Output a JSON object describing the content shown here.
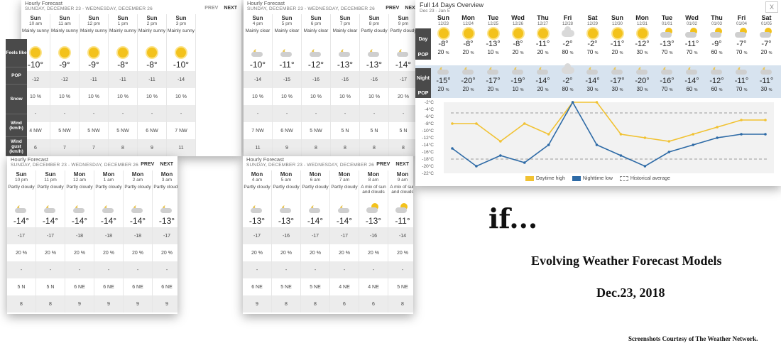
{
  "common": {
    "title": "Hourly Forecast",
    "range": "SUNDAY, DECEMBER 23 - WEDNESDAY, DECEMBER 26",
    "prev": "PREV",
    "next": "NEXT"
  },
  "side_labels": [
    "Feels like",
    "POP",
    "Snow",
    "Wind (km/h)",
    "Wind gust (km/h)"
  ],
  "panel1": {
    "cols": [
      {
        "day": "Sun",
        "time": "10 am",
        "cond": "Mainly sunny",
        "icon": "sun",
        "temp": "-10°",
        "feels": "-12",
        "pop": "10 %",
        "snow": "-",
        "wind": "4 NW",
        "gust": "6"
      },
      {
        "day": "Sun",
        "time": "11 am",
        "cond": "Mainly sunny",
        "icon": "sun",
        "temp": "-9°",
        "feels": "-12",
        "pop": "10 %",
        "snow": "-",
        "wind": "5 NW",
        "gust": "7"
      },
      {
        "day": "Sun",
        "time": "12 pm",
        "cond": "Mainly sunny",
        "icon": "sun",
        "temp": "-9°",
        "feels": "-11",
        "pop": "10 %",
        "snow": "-",
        "wind": "5 NW",
        "gust": "7"
      },
      {
        "day": "Sun",
        "time": "1 pm",
        "cond": "Mainly sunny",
        "icon": "sun",
        "temp": "-8°",
        "feels": "-11",
        "pop": "10 %",
        "snow": "-",
        "wind": "5 NW",
        "gust": "8"
      },
      {
        "day": "Sun",
        "time": "2 pm",
        "cond": "Mainly sunny",
        "icon": "sun",
        "temp": "-8°",
        "feels": "-11",
        "pop": "10 %",
        "snow": "-",
        "wind": "6 NW",
        "gust": "9"
      },
      {
        "day": "Sun",
        "time": "3 pm",
        "cond": "Mainly sunny",
        "icon": "sun",
        "temp": "-10°",
        "feels": "-14",
        "pop": "10 %",
        "snow": "-",
        "wind": "7 NW",
        "gust": "11"
      }
    ]
  },
  "panel2": {
    "cols": [
      {
        "day": "Sun",
        "time": "4 pm",
        "cond": "Mainly clear",
        "icon": "moon",
        "temp": "-10°",
        "feels": "-14",
        "pop": "10 %",
        "snow": "-",
        "wind": "7 NW",
        "gust": "11"
      },
      {
        "day": "Sun",
        "time": "5 pm",
        "cond": "Mainly clear",
        "icon": "moon",
        "temp": "-11°",
        "feels": "-15",
        "pop": "10 %",
        "snow": "-",
        "wind": "6 NW",
        "gust": "9"
      },
      {
        "day": "Sun",
        "time": "6 pm",
        "cond": "Mainly clear",
        "icon": "moon",
        "temp": "-12°",
        "feels": "-16",
        "pop": "10 %",
        "snow": "-",
        "wind": "5 NW",
        "gust": "8"
      },
      {
        "day": "Sun",
        "time": "7 pm",
        "cond": "Mainly clear",
        "icon": "moon",
        "temp": "-13°",
        "feels": "-16",
        "pop": "10 %",
        "snow": "-",
        "wind": "5 N",
        "gust": "8"
      },
      {
        "day": "Sun",
        "time": "8 pm",
        "cond": "Partly cloudy",
        "icon": "moon",
        "temp": "-13°",
        "feels": "-16",
        "pop": "10 %",
        "snow": "-",
        "wind": "5 N",
        "gust": "8"
      },
      {
        "day": "Sun",
        "time": "9 pm",
        "cond": "Partly cloudy",
        "icon": "moon",
        "temp": "-14°",
        "feels": "-17",
        "pop": "20 %",
        "snow": "-",
        "wind": "5 N",
        "gust": "8"
      }
    ]
  },
  "panel3": {
    "cols": [
      {
        "day": "Sun",
        "time": "10 pm",
        "cond": "Partly cloudy",
        "icon": "moon",
        "temp": "-14°",
        "feels": "-17",
        "pop": "20 %",
        "snow": "-",
        "wind": "5 N",
        "gust": "8"
      },
      {
        "day": "Sun",
        "time": "11 pm",
        "cond": "Partly cloudy",
        "icon": "moon",
        "temp": "-14°",
        "feels": "-17",
        "pop": "20 %",
        "snow": "-",
        "wind": "5 N",
        "gust": "8"
      },
      {
        "day": "Mon",
        "time": "12 am",
        "cond": "Partly cloudy",
        "icon": "moon",
        "temp": "-14°",
        "feels": "-18",
        "pop": "20 %",
        "snow": "-",
        "wind": "6 NE",
        "gust": "9"
      },
      {
        "day": "Mon",
        "time": "1 am",
        "cond": "Partly cloudy",
        "icon": "moon",
        "temp": "-14°",
        "feels": "-18",
        "pop": "20 %",
        "snow": "-",
        "wind": "6 NE",
        "gust": "9"
      },
      {
        "day": "Mon",
        "time": "2 am",
        "cond": "Partly cloudy",
        "icon": "moon",
        "temp": "-14°",
        "feels": "-18",
        "pop": "20 %",
        "snow": "-",
        "wind": "6 NE",
        "gust": "9"
      },
      {
        "day": "Mon",
        "time": "3 am",
        "cond": "Partly cloudy",
        "icon": "moon",
        "temp": "-13°",
        "feels": "-17",
        "pop": "20 %",
        "snow": "-",
        "wind": "6 NE",
        "gust": "9"
      }
    ]
  },
  "panel4": {
    "cols": [
      {
        "day": "Mon",
        "time": "4 am",
        "cond": "Partly cloudy",
        "icon": "moon",
        "temp": "-13°",
        "feels": "-17",
        "pop": "20 %",
        "snow": "-",
        "wind": "6 NE",
        "gust": "9"
      },
      {
        "day": "Mon",
        "time": "5 am",
        "cond": "Partly cloudy",
        "icon": "moon",
        "temp": "-13°",
        "feels": "-16",
        "pop": "20 %",
        "snow": "-",
        "wind": "5 NE",
        "gust": "8"
      },
      {
        "day": "Mon",
        "time": "6 am",
        "cond": "Partly cloudy",
        "icon": "moon",
        "temp": "-14°",
        "feels": "-17",
        "pop": "20 %",
        "snow": "-",
        "wind": "5 NE",
        "gust": "8"
      },
      {
        "day": "Mon",
        "time": "7 am",
        "cond": "Partly cloudy",
        "icon": "moon",
        "temp": "-14°",
        "feels": "-17",
        "pop": "20 %",
        "snow": "-",
        "wind": "4 NE",
        "gust": "6"
      },
      {
        "day": "Mon",
        "time": "8 am",
        "cond": "A mix of sun and clouds",
        "icon": "pc",
        "temp": "-13°",
        "feels": "-16",
        "pop": "20 %",
        "snow": "-",
        "wind": "4 NE",
        "gust": "6"
      },
      {
        "day": "Mon",
        "time": "9 am",
        "cond": "A mix of sun and clouds",
        "icon": "pc",
        "temp": "-11°",
        "feels": "-14",
        "pop": "20 %",
        "snow": "-",
        "wind": "5 NE",
        "gust": "8"
      }
    ]
  },
  "overview": {
    "title": "Full 14 Days Overview",
    "sub": "Dec 23 - Jan 5",
    "close": "X",
    "day_label": "Day",
    "pop_label": "POP",
    "night_label": "Night",
    "days": [
      {
        "d": "Sun",
        "date": "12/23",
        "hi": "-8°",
        "dpop": "20",
        "lo": "-15°",
        "npop": "20"
      },
      {
        "d": "Mon",
        "date": "12/24",
        "hi": "-8°",
        "dpop": "20",
        "lo": "-20°",
        "npop": "20"
      },
      {
        "d": "Tue",
        "date": "12/25",
        "hi": "-13°",
        "dpop": "10",
        "lo": "-17°",
        "npop": "20"
      },
      {
        "d": "Wed",
        "date": "12/26",
        "hi": "-8°",
        "dpop": "20",
        "lo": "-19°",
        "npop": "10"
      },
      {
        "d": "Thu",
        "date": "12/27",
        "hi": "-11°",
        "dpop": "20",
        "lo": "-14°",
        "npop": "20"
      },
      {
        "d": "Fri",
        "date": "12/28",
        "hi": "-2°",
        "dpop": "80",
        "lo": "-2°",
        "npop": "80"
      },
      {
        "d": "Sat",
        "date": "12/29",
        "hi": "-2°",
        "dpop": "70",
        "lo": "-14°",
        "npop": "30"
      },
      {
        "d": "Sun",
        "date": "12/30",
        "hi": "-11°",
        "dpop": "20",
        "lo": "-17°",
        "npop": "30"
      },
      {
        "d": "Mon",
        "date": "12/31",
        "hi": "-12°",
        "dpop": "30",
        "lo": "-20°",
        "npop": "30"
      },
      {
        "d": "Tue",
        "date": "01/01",
        "hi": "-13°",
        "dpop": "70",
        "lo": "-16°",
        "npop": "70"
      },
      {
        "d": "Wed",
        "date": "01/02",
        "hi": "-11°",
        "dpop": "70",
        "lo": "-14°",
        "npop": "60"
      },
      {
        "d": "Thu",
        "date": "01/03",
        "hi": "-9°",
        "dpop": "60",
        "lo": "-12°",
        "npop": "60"
      },
      {
        "d": "Fri",
        "date": "01/04",
        "hi": "-7°",
        "dpop": "70",
        "lo": "-11°",
        "npop": "70"
      },
      {
        "d": "Sat",
        "date": "01/05",
        "hi": "-7°",
        "dpop": "20",
        "lo": "-11°",
        "npop": "30"
      }
    ]
  },
  "chart_data": {
    "type": "line",
    "x": [
      "12/23",
      "12/24",
      "12/25",
      "12/26",
      "12/27",
      "12/28",
      "12/29",
      "12/30",
      "12/31",
      "01/01",
      "01/02",
      "01/03",
      "01/04",
      "01/05"
    ],
    "series": [
      {
        "name": "Daytime high",
        "color": "#f1c232",
        "values": [
          -8,
          -8,
          -13,
          -8,
          -11,
          -2,
          -2,
          -11,
          -12,
          -13,
          -11,
          -9,
          -7,
          -7
        ]
      },
      {
        "name": "Nighttime low",
        "color": "#2d6aa6",
        "values": [
          -15,
          -20,
          -17,
          -19,
          -14,
          -2,
          -14,
          -17,
          -20,
          -16,
          -14,
          -12,
          -11,
          -11
        ]
      }
    ],
    "historical_label": "Historical average",
    "historical": [
      -5,
      -18
    ],
    "yticks": [
      "-2°C",
      "-4°C",
      "-6°C",
      "-8°C",
      "-10°C",
      "-12°C",
      "-14°C",
      "-16°C",
      "-18°C",
      "-20°C",
      "-22°C"
    ],
    "ylim": [
      -22,
      -2
    ]
  },
  "percent": "%",
  "text": {
    "big": "if...",
    "title": "Evolving Weather Forecast Models",
    "date": "Dec.23, 2018",
    "credit": "Screenshots Courtesy of The Weather Network."
  }
}
